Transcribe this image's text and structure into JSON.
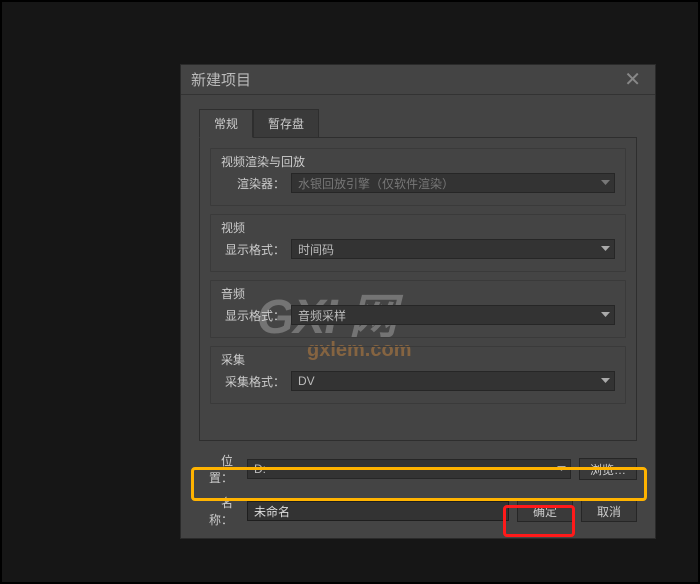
{
  "dialog": {
    "title": "新建项目",
    "tabs": {
      "general": "常规",
      "scratch": "暂存盘"
    },
    "groups": {
      "render": {
        "label": "视频渲染与回放",
        "renderer_label": "渲染器：",
        "renderer_value": "水银回放引擎（仅软件渲染）"
      },
      "video": {
        "label": "视频",
        "format_label": "显示格式：",
        "format_value": "时间码"
      },
      "audio": {
        "label": "音频",
        "format_label": "显示格式：",
        "format_value": "音频采样"
      },
      "capture": {
        "label": "采集",
        "format_label": "采集格式：",
        "format_value": "DV"
      }
    },
    "location": {
      "label": "位置：",
      "value": "D:"
    },
    "name": {
      "label": "名称：",
      "value": "未命名"
    },
    "buttons": {
      "browse": "浏览…",
      "ok": "确定",
      "cancel": "取消"
    }
  },
  "watermark": {
    "big": "GXI 网",
    "sub": "gxlem.com"
  }
}
